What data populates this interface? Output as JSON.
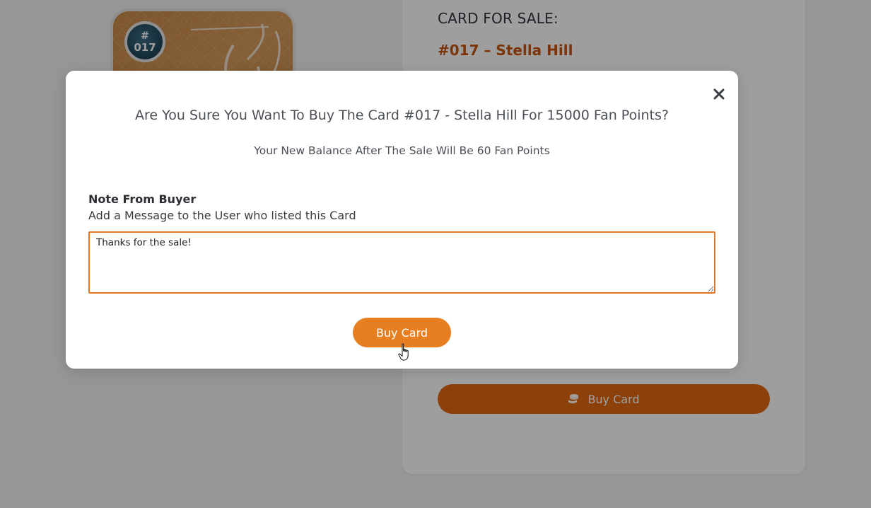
{
  "background": {
    "card_badge": {
      "hash": "#",
      "number": "017"
    },
    "sale_panel": {
      "heading": "CARD FOR SALE:",
      "card_title": "#017 – Stella Hill",
      "buy_button_label": "Buy Card",
      "buy_button_icon": "coins-icon"
    }
  },
  "modal": {
    "close_icon": "close-icon",
    "question": "Are You Sure You Want To Buy The Card #017 - Stella Hill For 15000 Fan Points?",
    "balance_text": "Your New Balance After The Sale Will Be 60 Fan Points",
    "note_title": "Note From Buyer",
    "note_subtitle": "Add a Message to the User who listed this Card",
    "note_value": "Thanks for the sale!",
    "buy_button_label": "Buy Card"
  },
  "colors": {
    "accent": "#e87e22",
    "title_accent": "#c9560e",
    "overlay": "rgba(0,0,0,0.38)"
  }
}
